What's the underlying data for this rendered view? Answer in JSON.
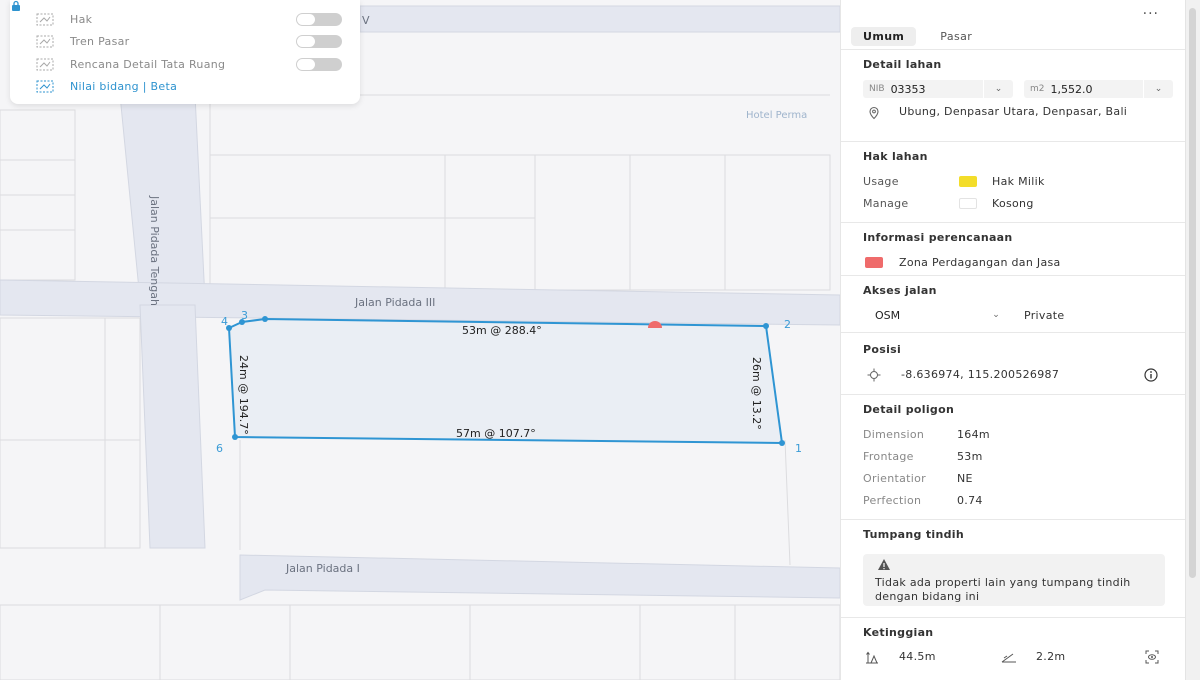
{
  "map": {
    "streets": {
      "top_partial": "V",
      "vertical_left": "Jalan Pidada Tengah",
      "middle": "Jalan Pidada III",
      "bottom": "Jalan Pidada I"
    },
    "poi": "Hotel Perma",
    "edges": {
      "top": "53m @ 288.4°",
      "bottom": "57m @ 107.7°",
      "left": "24m @ 194.7°",
      "right": "26m @ 13.2°"
    },
    "vertices": [
      "1",
      "2",
      "3",
      "4",
      "6"
    ],
    "colors": {
      "boundary": "#2f95d3",
      "fill": "#eaeef4",
      "road": "#e3e6ef"
    }
  },
  "layers": {
    "items": [
      {
        "label": "Hak",
        "icon": "layer-icon",
        "control": "toggle"
      },
      {
        "label": "Tren Pasar",
        "icon": "layer-icon",
        "control": "toggle"
      },
      {
        "label": "Rencana Detail Tata Ruang",
        "icon": "layer-icon",
        "control": "toggle"
      },
      {
        "label": "Nilai bidang | Beta",
        "icon": "layer-icon",
        "control": "lock-icon",
        "active": true
      }
    ]
  },
  "sidebar": {
    "more": "···",
    "tabs": [
      {
        "label": "Umum",
        "active": true
      },
      {
        "label": "Pasar"
      }
    ],
    "detail_lahan": {
      "title": "Detail lahan",
      "nib_prefix": "NIB",
      "nib": "03353",
      "area_prefix": "m2",
      "area": "1,552.0",
      "address": "Ubung, Denpasar Utara, Denpasar, Bali"
    },
    "hak_lahan": {
      "title": "Hak lahan",
      "usage_label": "Usage",
      "usage_value": "Hak Milik",
      "usage_color": "#f3dd2a",
      "manage_label": "Manage",
      "manage_value": "Kosong",
      "manage_color": "#ffffff"
    },
    "perencanaan": {
      "title": "Informasi perencanaan",
      "zone": "Zona Perdagangan dan Jasa",
      "zone_color": "#ef6b6b"
    },
    "akses": {
      "title": "Akses jalan",
      "source": "OSM",
      "value": "Private"
    },
    "posisi": {
      "title": "Posisi",
      "coords": "-8.636974, 115.200526987"
    },
    "poligon": {
      "title": "Detail poligon",
      "rows": [
        {
          "label": "Dimension",
          "value": "164m"
        },
        {
          "label": "Frontage",
          "value": "53m"
        },
        {
          "label": "Orientatior",
          "value": "NE"
        },
        {
          "label": "Perfection",
          "value": "0.74"
        }
      ]
    },
    "tumpang": {
      "title": "Tumpang tindih",
      "text": "Tidak ada properti lain yang tumpang tindih dengan bidang ini"
    },
    "ketinggian": {
      "title": "Ketinggian",
      "elevation": "44.5m",
      "slope": "2.2m"
    }
  }
}
